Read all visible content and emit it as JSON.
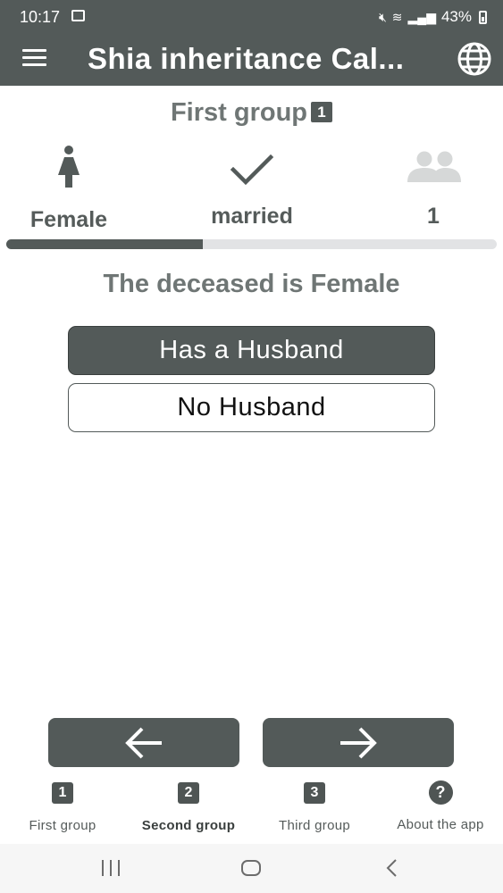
{
  "status_bar": {
    "time": "10:17",
    "battery": "43%",
    "icons": [
      "gallery-icon",
      "mute-icon",
      "wifi-icon",
      "volte-icon",
      "signal-icon",
      "battery-icon"
    ]
  },
  "app_bar": {
    "title": "Shia inheritance Cal...",
    "menu_icon": "menu-icon",
    "language_icon": "globe-icon"
  },
  "group": {
    "title": "First group",
    "number": "1"
  },
  "steps": [
    {
      "icon": "female-icon",
      "label": "Female"
    },
    {
      "icon": "check-icon",
      "label": "married"
    },
    {
      "icon": "people-icon",
      "label": "1"
    }
  ],
  "progress": {
    "fraction": 0.4,
    "fill_color": "#535a59",
    "track_color": "#e2e3e5"
  },
  "question": "The deceased is Female",
  "options": [
    {
      "label": "Has a Husband",
      "selected": true
    },
    {
      "label": "No Husband",
      "selected": false
    }
  ],
  "navigation": {
    "back_icon": "arrow-left-icon",
    "next_icon": "arrow-right-icon"
  },
  "tabs": [
    {
      "icon_text": "1",
      "label": "First group",
      "active": false
    },
    {
      "icon_text": "2",
      "label": "Second group",
      "active": true
    },
    {
      "icon_text": "3",
      "label": "Third group",
      "active": false
    },
    {
      "icon_text": "?",
      "label": "About the app",
      "active": false
    }
  ],
  "colors": {
    "primary": "#535a59",
    "text": "#555b5a",
    "heading": "#6f7675"
  }
}
